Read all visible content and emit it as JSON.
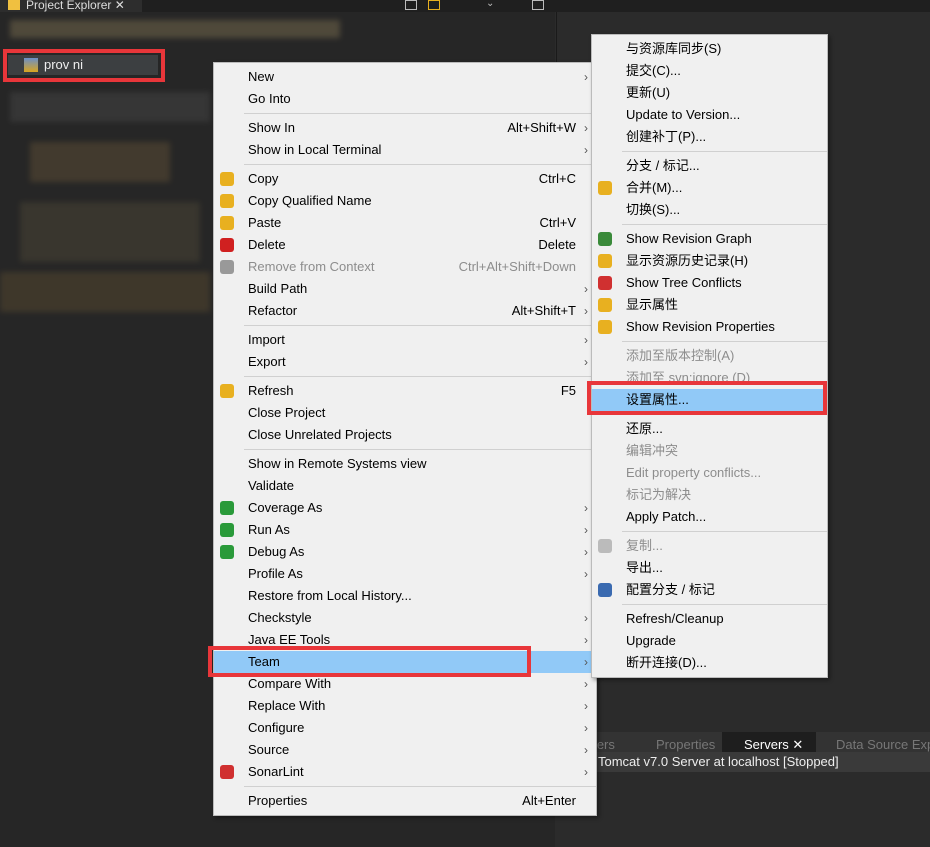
{
  "window": {
    "explorer_tab": "Project Explorer",
    "project_label": "prov          ni"
  },
  "main_menu": [
    {
      "label": "New",
      "arrow": true
    },
    {
      "label": "Go Into"
    },
    {
      "sep": true
    },
    {
      "label": "Show In",
      "shortcut": "Alt+Shift+W",
      "arrow": true
    },
    {
      "label": "Show in Local Terminal",
      "arrow": true
    },
    {
      "sep": true
    },
    {
      "label": "Copy",
      "shortcut": "Ctrl+C",
      "icon": "copy-icon",
      "color": "#e8b020"
    },
    {
      "label": "Copy Qualified Name",
      "icon": "copy-qualified-icon",
      "color": "#e8b020"
    },
    {
      "label": "Paste",
      "shortcut": "Ctrl+V",
      "icon": "paste-icon",
      "color": "#e8b020"
    },
    {
      "label": "Delete",
      "shortcut": "Delete",
      "icon": "delete-icon",
      "color": "#d02020"
    },
    {
      "label": "Remove from Context",
      "shortcut": "Ctrl+Alt+Shift+Down",
      "disabled": true,
      "icon": "remove-context-icon",
      "color": "#999"
    },
    {
      "label": "Build Path",
      "arrow": true
    },
    {
      "label": "Refactor",
      "shortcut": "Alt+Shift+T",
      "arrow": true
    },
    {
      "sep": true
    },
    {
      "label": "Import",
      "arrow": true
    },
    {
      "label": "Export",
      "arrow": true
    },
    {
      "sep": true
    },
    {
      "label": "Refresh",
      "shortcut": "F5",
      "icon": "refresh-icon",
      "color": "#e8b020"
    },
    {
      "label": "Close Project"
    },
    {
      "label": "Close Unrelated Projects"
    },
    {
      "sep": true
    },
    {
      "label": "Show in Remote Systems view"
    },
    {
      "label": "Validate"
    },
    {
      "label": "Coverage As",
      "arrow": true,
      "icon": "coverage-icon",
      "color": "#2a9a3a"
    },
    {
      "label": "Run As",
      "arrow": true,
      "icon": "run-icon",
      "color": "#2a9a3a"
    },
    {
      "label": "Debug As",
      "arrow": true,
      "icon": "debug-icon",
      "color": "#2a9a3a"
    },
    {
      "label": "Profile As",
      "arrow": true
    },
    {
      "label": "Restore from Local History..."
    },
    {
      "label": "Checkstyle",
      "arrow": true
    },
    {
      "label": "Java EE Tools",
      "arrow": true
    },
    {
      "label": "Team",
      "arrow": true,
      "highlighted": true
    },
    {
      "label": "Compare With",
      "arrow": true
    },
    {
      "label": "Replace With",
      "arrow": true
    },
    {
      "label": "Configure",
      "arrow": true
    },
    {
      "label": "Source",
      "arrow": true
    },
    {
      "label": "SonarLint",
      "arrow": true,
      "icon": "sonarlint-icon",
      "color": "#d03030"
    },
    {
      "sep": true
    },
    {
      "label": "Properties",
      "shortcut": "Alt+Enter"
    }
  ],
  "team_menu": [
    {
      "label": "与资源库同步(S)"
    },
    {
      "label": "提交(C)..."
    },
    {
      "label": "更新(U)"
    },
    {
      "label": "Update to Version..."
    },
    {
      "label": "创建补丁(P)..."
    },
    {
      "sep": true
    },
    {
      "label": "分支 / 标记..."
    },
    {
      "label": "合并(M)...",
      "icon": "merge-icon",
      "color": "#e8b020"
    },
    {
      "label": "切换(S)..."
    },
    {
      "sep": true
    },
    {
      "label": "Show Revision Graph",
      "icon": "revision-graph-icon",
      "color": "#3a8a3a"
    },
    {
      "label": "显示资源历史记录(H)",
      "icon": "history-icon",
      "color": "#e8b020"
    },
    {
      "label": "Show Tree Conflicts",
      "icon": "tree-conflicts-icon",
      "color": "#d03030"
    },
    {
      "label": "显示属性",
      "icon": "properties-icon",
      "color": "#e8b020"
    },
    {
      "label": "Show Revision Properties",
      "icon": "revision-properties-icon",
      "color": "#e8b020"
    },
    {
      "sep": true
    },
    {
      "label": "添加至版本控制(A)",
      "disabled": true
    },
    {
      "label": "添加至 svn:ignore (D)",
      "disabled": true
    },
    {
      "label": "设置属性...",
      "highlighted": true
    },
    {
      "sep": true
    },
    {
      "label": "还原..."
    },
    {
      "label": "编辑冲突",
      "disabled": true
    },
    {
      "label": "Edit property conflicts...",
      "disabled": true
    },
    {
      "label": "标记为解决",
      "disabled": true
    },
    {
      "label": "Apply Patch..."
    },
    {
      "sep": true
    },
    {
      "label": "复制...",
      "disabled": true,
      "icon": "copy-icon",
      "color": "#bbb"
    },
    {
      "label": "导出..."
    },
    {
      "label": "配置分支 / 标记",
      "icon": "branch-config-icon",
      "color": "#3a6ab0"
    },
    {
      "sep": true
    },
    {
      "label": "Refresh/Cleanup"
    },
    {
      "label": "Upgrade"
    },
    {
      "label": "断开连接(D)..."
    }
  ],
  "bottom": {
    "tabs": [
      "rkers",
      "Properties",
      "Servers",
      "Data Source Exp"
    ],
    "active_tab": "Servers",
    "server_row": "Tomcat v7.0 Server at localhost  [Stopped]"
  },
  "colors": {
    "highlight": "#91c9f7",
    "annotation": "#e8363a"
  }
}
